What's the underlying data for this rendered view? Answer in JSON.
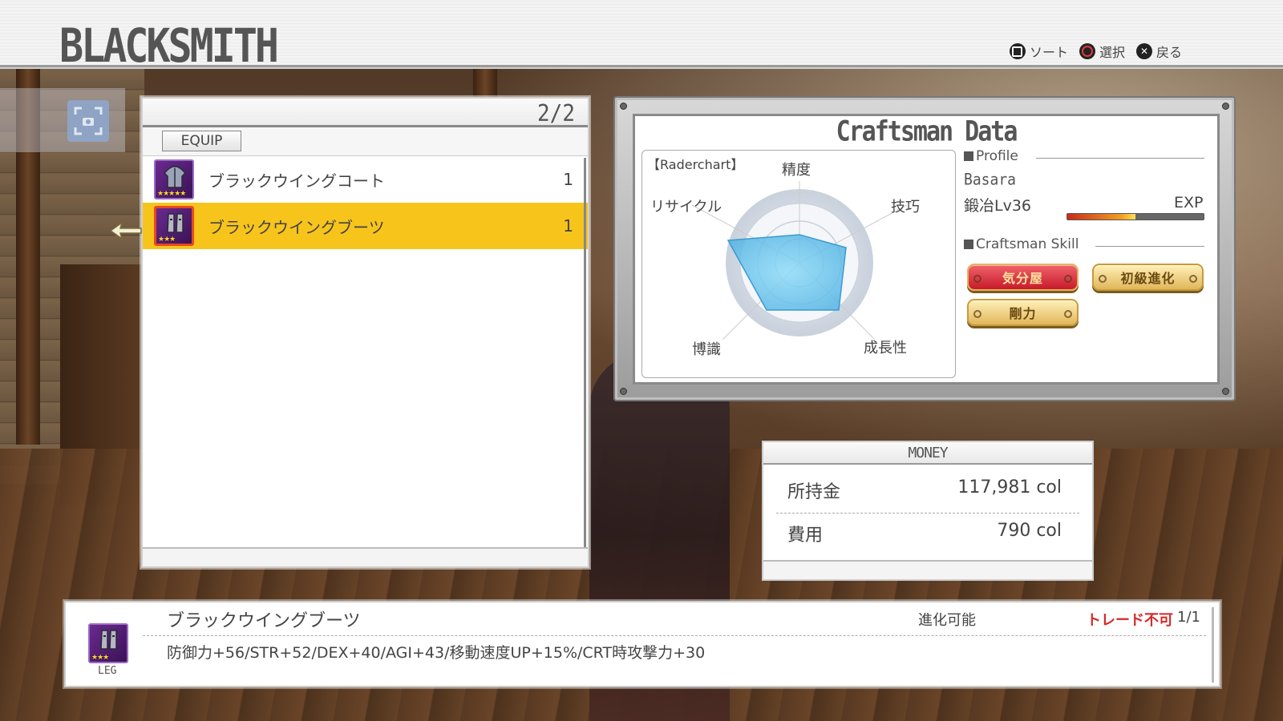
{
  "header": {
    "title": "BLACKSMITH",
    "hints": [
      {
        "glyph": "square",
        "label": "ソート"
      },
      {
        "glyph": "circle",
        "label": "選択"
      },
      {
        "glyph": "cross",
        "label": "戻る"
      }
    ]
  },
  "list": {
    "page": "2/2",
    "tab_label": "EQUIP",
    "items": [
      {
        "name": "ブラックウイングコート",
        "qty": "1",
        "stars": "★★★★★",
        "selected": false
      },
      {
        "name": "ブラックウイングブーツ",
        "qty": "1",
        "stars": "★★★",
        "selected": true
      }
    ]
  },
  "craftsman": {
    "title": "Craftsman Data",
    "radar": {
      "title": "【Raderchart】",
      "axes": [
        "精度",
        "技巧",
        "成長性",
        "博識",
        "リサイクル"
      ]
    },
    "profile": {
      "heading": "Profile",
      "name": "Basara",
      "level": "鍛冶Lv36",
      "exp_label": "EXP",
      "exp_progress": 0.5
    },
    "skills_heading": "Craftsman Skill",
    "skills": [
      {
        "label": "気分屋",
        "style": "red"
      },
      {
        "label": "初級進化",
        "style": "gold"
      },
      {
        "label": "剛力",
        "style": "gold"
      }
    ]
  },
  "money": {
    "title": "MONEY",
    "owned_label": "所持金",
    "owned_value": "117,981 col",
    "cost_label": "費用",
    "cost_value": "790 col"
  },
  "detail": {
    "name": "ブラックウイングブーツ",
    "slot": "LEG",
    "stars": "★★★",
    "evolve": "進化可能",
    "trade": "トレード不可",
    "count": "1/1",
    "stats": "防御力+56/STR+52/DEX+40/AGI+43/移動速度UP+15%/CRT時攻撃力+30"
  },
  "colors": {
    "selected_row": "#f7c41c",
    "trade_warning": "#d42a2a",
    "radar_fill": "#5bbde8"
  }
}
